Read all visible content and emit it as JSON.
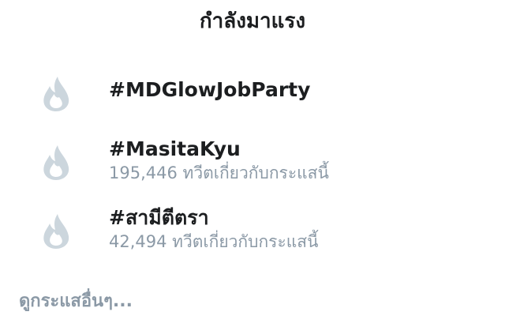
{
  "header": {
    "title": "กำลังมาแรง"
  },
  "trends": [
    {
      "name": "#MDGlowJobParty",
      "count_text": "",
      "icon": "flame-icon"
    },
    {
      "name": "#MasitaKyu",
      "count_text": "195,446 ทวีตเกี่ยวกับกระแสนี้",
      "icon": "flame-icon"
    },
    {
      "name": "#สามีตีตรา",
      "count_text": "42,494 ทวีตเกี่ยวกับกระแสนี้",
      "icon": "flame-icon"
    }
  ],
  "footer": {
    "more_label": "ดูกระแสอื่นๆ..."
  },
  "colors": {
    "text": "#1c1e20",
    "muted": "#8b99a6",
    "icon": "#ccd6dd"
  }
}
